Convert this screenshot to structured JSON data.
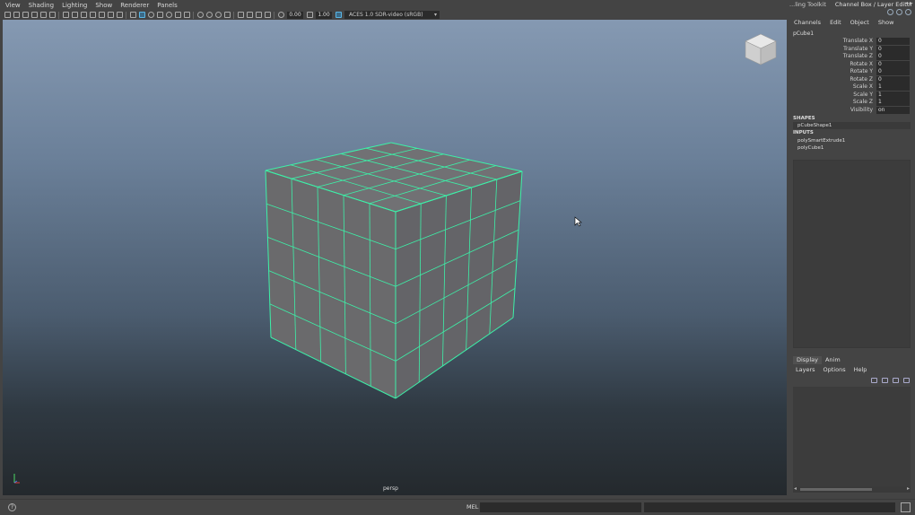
{
  "viewport": {
    "menu": [
      "View",
      "Shading",
      "Lighting",
      "Show",
      "Renderer",
      "Panels"
    ],
    "toolbar": {
      "field_a": "0.00",
      "field_b": "1.00",
      "color_space": "ACES 1.0 SDR-video (sRGB)"
    },
    "camera_label": "persp",
    "colors": {
      "wireframe": "#3df0a8",
      "face": "#6a6a6c"
    }
  },
  "right_panel": {
    "tabs": [
      "...ling Toolkit",
      "Channel Box / Layer Editor"
    ],
    "channel_menu": [
      "Channels",
      "Edit",
      "Object",
      "Show"
    ],
    "object_name": "pCube1",
    "attributes": [
      {
        "label": "Translate X",
        "value": "0"
      },
      {
        "label": "Translate Y",
        "value": "0"
      },
      {
        "label": "Translate Z",
        "value": "0"
      },
      {
        "label": "Rotate X",
        "value": "0"
      },
      {
        "label": "Rotate Y",
        "value": "0"
      },
      {
        "label": "Rotate Z",
        "value": "0"
      },
      {
        "label": "Scale X",
        "value": "1"
      },
      {
        "label": "Scale Y",
        "value": "1"
      },
      {
        "label": "Scale Z",
        "value": "1"
      },
      {
        "label": "Visibility",
        "value": "on"
      }
    ],
    "shapes_header": "SHAPES",
    "shape_node": "pCubeShape1",
    "inputs_header": "INPUTS",
    "input_nodes": [
      "polySmartExtrude1",
      "polyCube1"
    ],
    "layer_tabs": [
      "Display",
      "Anim"
    ],
    "layer_menu": [
      "Layers",
      "Options",
      "Help"
    ]
  },
  "bottom": {
    "help_glyph": "?",
    "mel_label": "MEL"
  }
}
